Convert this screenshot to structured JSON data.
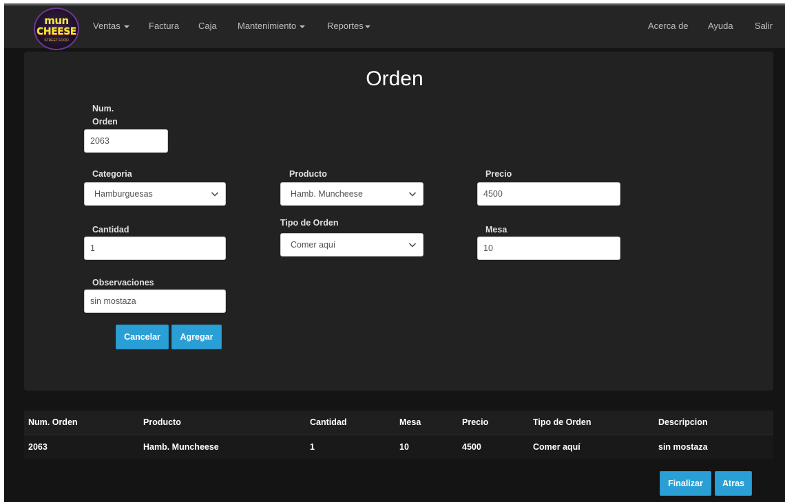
{
  "logo": {
    "top_text": "mun",
    "bottom_text": "CHEESE",
    "small_text": "STREET FOOD"
  },
  "nav": {
    "left_items": [
      {
        "label": "Ventas",
        "dropdown": true
      },
      {
        "label": "Factura",
        "dropdown": false
      },
      {
        "label": "Caja",
        "dropdown": false
      },
      {
        "label": "Mantenimiento",
        "dropdown": true
      },
      {
        "label": "Reportes",
        "dropdown": true
      }
    ],
    "right_items": [
      {
        "label": "Acerca de"
      },
      {
        "label": "Ayuda"
      },
      {
        "label": "Salir"
      }
    ]
  },
  "form": {
    "title": "Orden",
    "num_orden_label_line1": "Num.",
    "num_orden_label_line2": "Orden",
    "num_orden_value": "2063",
    "categoria_label": "Categoria",
    "categoria_value": "Hamburguesas",
    "producto_label": "Producto",
    "producto_value": "Hamb. Muncheese",
    "precio_label": "Precio",
    "precio_value": "4500",
    "cantidad_label": "Cantidad",
    "cantidad_value": "1",
    "tipo_orden_label": "Tipo de Orden",
    "tipo_orden_value": "Comer aquí",
    "mesa_label": "Mesa",
    "mesa_value": "10",
    "observaciones_label": "Observaciones",
    "observaciones_value": "sin mostaza",
    "cancel_label": "Cancelar",
    "add_label": "Agregar"
  },
  "table": {
    "headers": [
      "Num. Orden",
      "Producto",
      "Cantidad",
      "Mesa",
      "Precio",
      "Tipo de Orden",
      "Descripcion"
    ],
    "rows": [
      [
        "2063",
        "Hamb. Muncheese",
        "1",
        "10",
        "4500",
        "Comer aquí",
        "sin mostaza"
      ]
    ]
  },
  "footer": {
    "finish_label": "Finalizar",
    "back_label": "Atras"
  },
  "colors": {
    "accent": "#2a9fd6",
    "navbar": "#252525",
    "panel": "#222222",
    "background": "#141414"
  }
}
